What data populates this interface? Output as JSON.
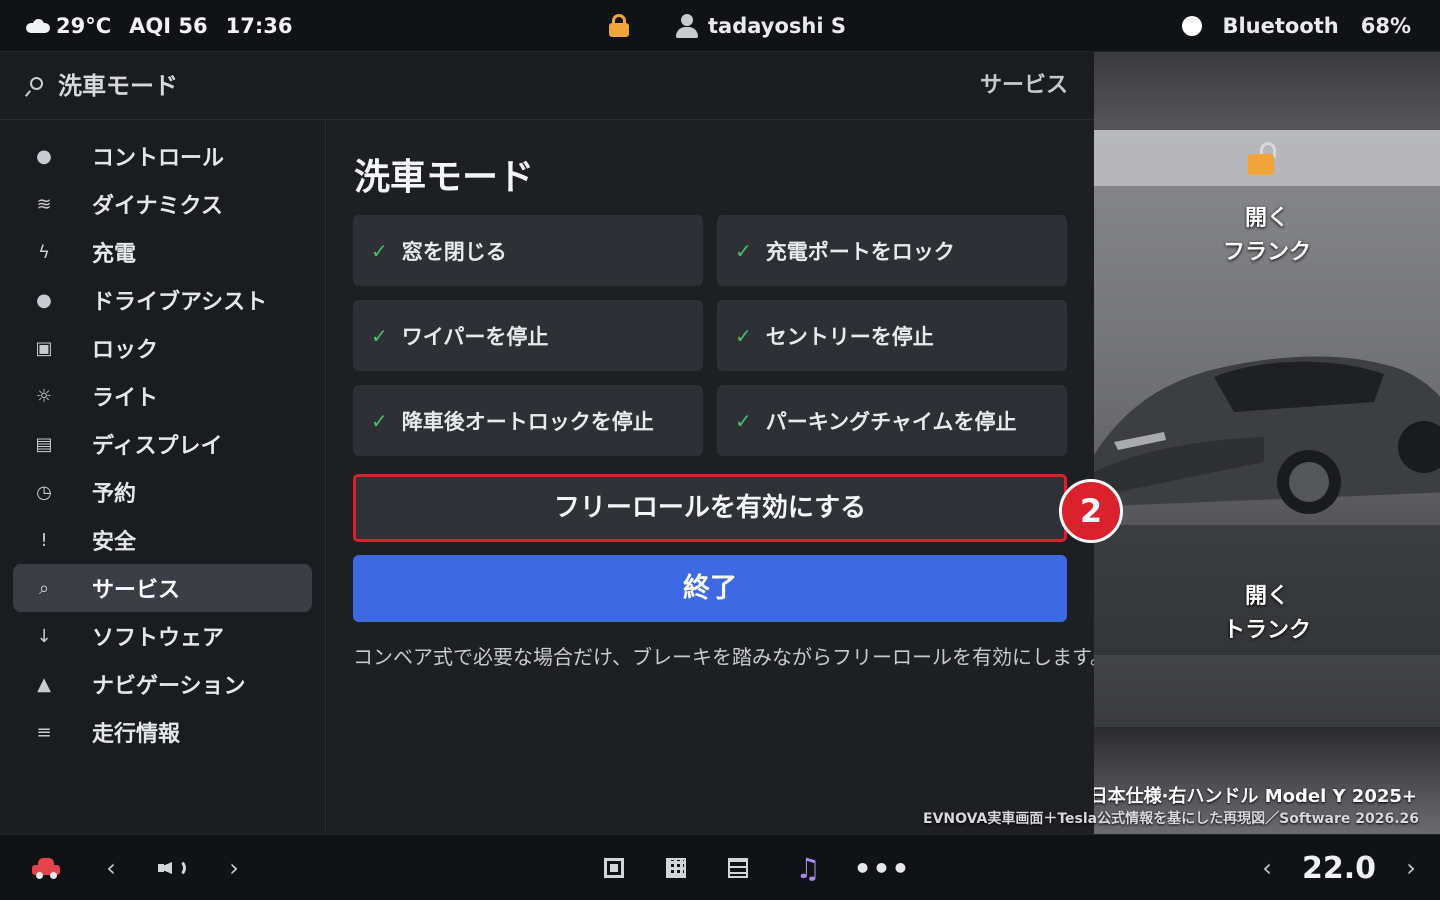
{
  "status_bar": {
    "weather_icon": "cloud-icon",
    "temperature": "29°C",
    "aqi": "AQI 56",
    "time": "17:36",
    "lock_icon": "lock-icon",
    "user_name": "tadayoshi S",
    "bluetooth_label": "Bluetooth",
    "battery": "68%"
  },
  "header": {
    "search_text": "洗車モード",
    "service_label": "サービス"
  },
  "sidebar": {
    "items": [
      {
        "label": "コントロール",
        "icon": "●"
      },
      {
        "label": "ダイナミクス",
        "icon": "≋"
      },
      {
        "label": "充電",
        "icon": "ϟ"
      },
      {
        "label": "ドライブアシスト",
        "icon": "●"
      },
      {
        "label": "ロック",
        "icon": "▣"
      },
      {
        "label": "ライト",
        "icon": "☼"
      },
      {
        "label": "ディスプレイ",
        "icon": "▤"
      },
      {
        "label": "予約",
        "icon": "◷"
      },
      {
        "label": "安全",
        "icon": "!"
      },
      {
        "label": "サービス",
        "icon": "⌕"
      },
      {
        "label": "ソフトウェア",
        "icon": "↓"
      },
      {
        "label": "ナビゲーション",
        "icon": "▲"
      },
      {
        "label": "走行情報",
        "icon": "≡"
      }
    ],
    "active_item": "サービス"
  },
  "main": {
    "title": "洗車モード",
    "checklist": [
      "窓を閉じる",
      "充電ポートをロック",
      "ワイパーを停止",
      "セントリーを停止",
      "降車後オートロックを停止",
      "パーキングチャイムを停止"
    ],
    "check_mark": "✓",
    "freeroll_button": "フリーロールを有効にする",
    "end_button": "終了",
    "note": "コンベア式で必要な場合だけ、ブレーキを踏みながらフリーロールを有効にします。",
    "step_badge": "2"
  },
  "vehicle_panel": {
    "frunk_open_label_1": "開く",
    "frunk_label": "フランク",
    "trunk_open_label": "開く",
    "trunk_label": "トランク",
    "model_caption": "日本仕様·右ハンドル Model Y 2025+",
    "credit_caption": "EVNOVA実車画面＋Tesla公式情報を基にした再現図／Software 2026.26"
  },
  "bottom_bar": {
    "left_chevron": "‹",
    "right_chevron": "›",
    "music_icon": "♫",
    "more_icon": "•••",
    "temperature_setting": "22.0"
  },
  "colors": {
    "accent_blue": "#3e6ae1",
    "highlight_red": "#d9222e",
    "check_green": "#45c06a",
    "lock_orange": "#f0a43a"
  }
}
